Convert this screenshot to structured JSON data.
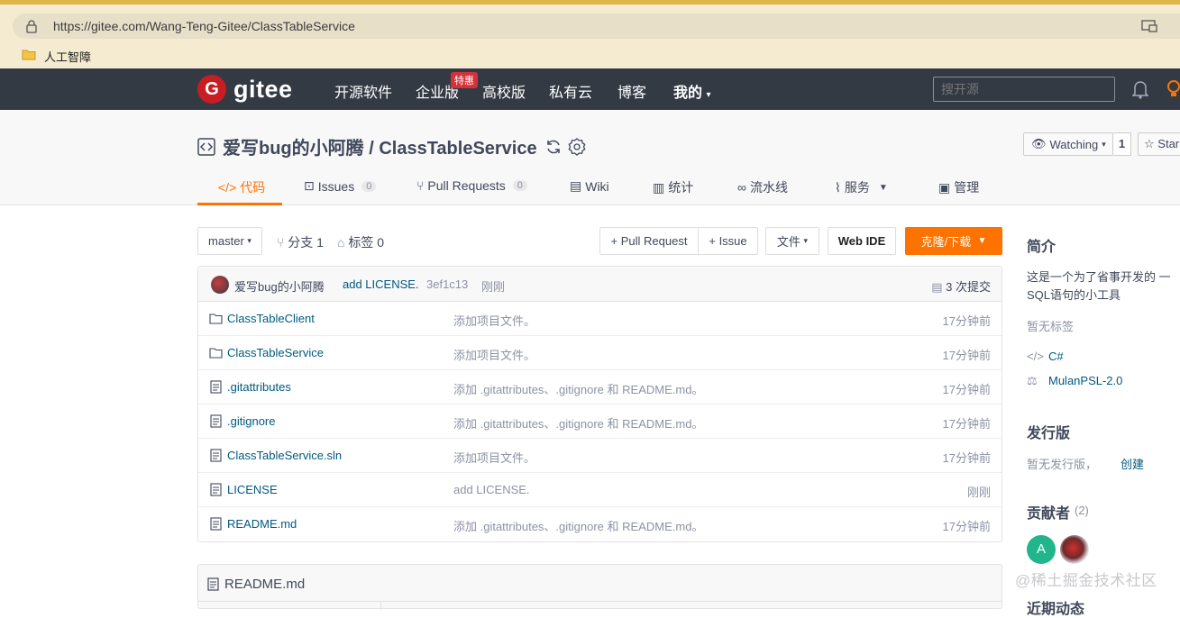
{
  "browser": {
    "url": "https://gitee.com/Wang-Teng-Gitee/ClassTableService",
    "bookmark": "人工智障"
  },
  "nav": {
    "logo": "gitee",
    "logo_mark": "G",
    "items": [
      "开源软件",
      "企业版",
      "高校版",
      "私有云",
      "博客",
      "我的"
    ],
    "badge": "特惠",
    "search_placeholder": "搜开源"
  },
  "repo": {
    "title": "爱写bug的小阿腾 / ClassTableService",
    "watch_label": "Watching",
    "watch_count": "1",
    "star_label": "Star"
  },
  "tabs": {
    "code": "代码",
    "issues": "Issues",
    "issues_count": "0",
    "pulls": "Pull Requests",
    "pulls_count": "0",
    "wiki": "Wiki",
    "stats": "统计",
    "pipeline": "流水线",
    "services": "服务",
    "manage": "管理"
  },
  "toolbar": {
    "branch": "master",
    "branches": "分支 1",
    "tags": "标签 0",
    "pull_request": "+ Pull Request",
    "issue": "+ Issue",
    "file": "文件",
    "web_ide": "Web IDE",
    "clone": "克隆/下载"
  },
  "commit": {
    "author": "爱写bug的小阿腾",
    "message": "add LICENSE.",
    "hash": "3ef1c13",
    "time": "刚刚",
    "count": "3 次提交"
  },
  "files": [
    {
      "name": "ClassTableClient",
      "type": "folder",
      "message": "添加项目文件。",
      "time": "17分钟前"
    },
    {
      "name": "ClassTableService",
      "type": "folder",
      "message": "添加项目文件。",
      "time": "17分钟前"
    },
    {
      "name": ".gitattributes",
      "type": "file",
      "message": "添加 .gitattributes、.gitignore 和 README.md。",
      "time": "17分钟前"
    },
    {
      "name": ".gitignore",
      "type": "file",
      "message": "添加 .gitattributes、.gitignore 和 README.md。",
      "time": "17分钟前"
    },
    {
      "name": "ClassTableService.sln",
      "type": "file",
      "message": "添加项目文件。",
      "time": "17分钟前"
    },
    {
      "name": "LICENSE",
      "type": "file",
      "message": "add LICENSE.",
      "time": "刚刚"
    },
    {
      "name": "README.md",
      "type": "file",
      "message": "添加 .gitattributes、.gitignore 和 README.md。",
      "time": "17分钟前"
    }
  ],
  "readme": {
    "title": "README.md"
  },
  "sidebar": {
    "intro_title": "简介",
    "intro_line1": "这是一个为了省事开发的 一",
    "intro_line2": "SQL语句的小工具",
    "no_tags": "暂无标签",
    "language": "C#",
    "license": "MulanPSL-2.0",
    "release_title": "发行版",
    "no_release": "暂无发行版，",
    "create": "创建",
    "contrib_title": "贡献者",
    "contrib_count": "(2)",
    "contrib_a": "A",
    "recent_title": "近期动态"
  },
  "watermark": "@稀土掘金技术社区"
}
